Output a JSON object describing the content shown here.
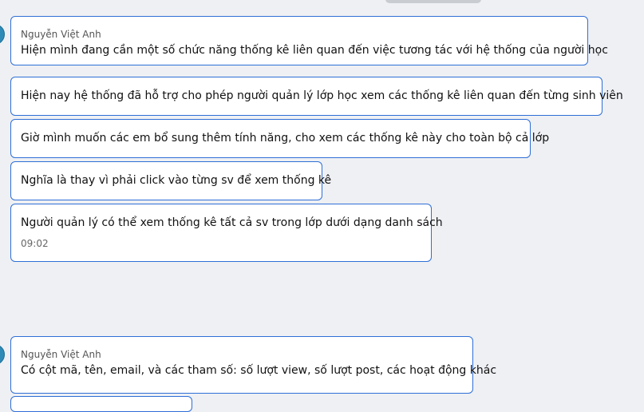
{
  "chat": {
    "group1": {
      "sender": "Nguyễn Việt Anh",
      "messages": [
        "Hiện mình đang cần một số chức năng thống kê liên quan đến việc tương tác với hệ thống của người học",
        "Hiện nay hệ thống đã hỗ trợ cho phép người quản lý lớp học xem các thống kê liên quan đến từng sinh viên",
        "Giờ mình muốn các em bổ sung thêm tính năng, cho xem các thống kê này cho toàn bộ cả lớp",
        "Nghĩa là thay vì phải click vào từng sv để xem thống kê",
        "Người quản lý có thể xem thống kê tất cả sv trong lớp dưới dạng danh sách"
      ],
      "time": "09:02"
    },
    "group2": {
      "sender": "Nguyễn Việt Anh",
      "messages": [
        "Có cột mã, tên, email, và các tham số: số lượt view, số lượt post, các hoạt động khác"
      ]
    }
  }
}
